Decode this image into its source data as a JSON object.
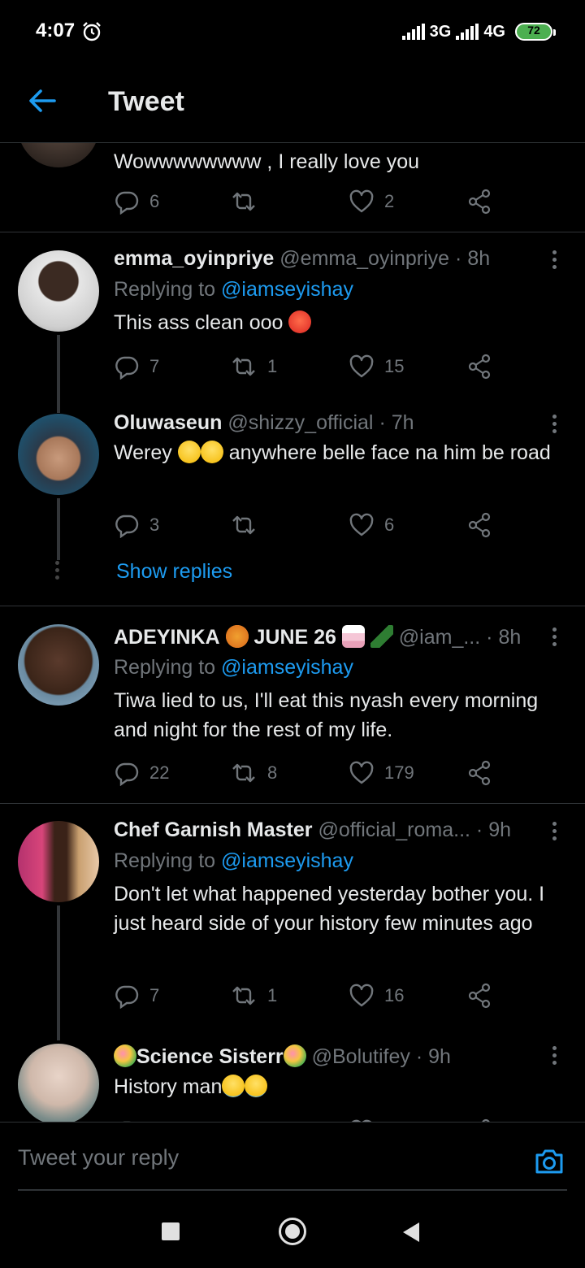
{
  "status_bar": {
    "time": "4:07",
    "network_1": "3G",
    "network_2": "4G",
    "battery": "72"
  },
  "header": {
    "title": "Tweet",
    "back_icon": "arrow-left-icon"
  },
  "tweets": [
    {
      "text": "Wowwwwwwww , I really love you",
      "replies": "6",
      "retweets": "",
      "likes": "2"
    },
    {
      "name": "emma_oyinpriye",
      "handle": "@emma_oyinpriye",
      "dot": "·",
      "time": "8h",
      "replying_label": "Replying to",
      "replying_handle": "@iamseyishay",
      "text": "This ass clean ooo",
      "replies": "7",
      "retweets": "1",
      "likes": "15"
    },
    {
      "name": "Oluwaseun",
      "handle": "@shizzy_official",
      "dot": "·",
      "time": "7h",
      "text_before": "Werey",
      "text_after": "anywhere belle face na him be road",
      "replies": "3",
      "retweets": "",
      "likes": "6",
      "show_replies": "Show replies"
    },
    {
      "name_a": "ADEYINKA",
      "name_b": "JUNE 26",
      "handle": "@iam_...",
      "dot": "·",
      "time": "8h",
      "replying_label": "Replying to",
      "replying_handle": "@iamseyishay",
      "text": "Tiwa lied to us, I'll eat this nyash every morning and night for the rest of my life.",
      "replies": "22",
      "retweets": "8",
      "likes": "179"
    },
    {
      "name": "Chef Garnish Master",
      "handle": "@official_roma...",
      "dot": "·",
      "time": "9h",
      "replying_label": "Replying to",
      "replying_handle": "@iamseyishay",
      "text": "Don't let what happened yesterday bother you. I just heard side of your history few minutes ago",
      "replies": "7",
      "retweets": "1",
      "likes": "16"
    },
    {
      "name": "Science Sisterr",
      "handle": "@Bolutifey",
      "dot": "·",
      "time": "9h",
      "text": "History man"
    }
  ],
  "reply_bar": {
    "placeholder": "Tweet your reply",
    "camera_icon": "camera-icon"
  },
  "colors": {
    "background": "#000000",
    "accent": "#1d9bf0",
    "muted": "#71767b",
    "divider": "#2f3336"
  }
}
